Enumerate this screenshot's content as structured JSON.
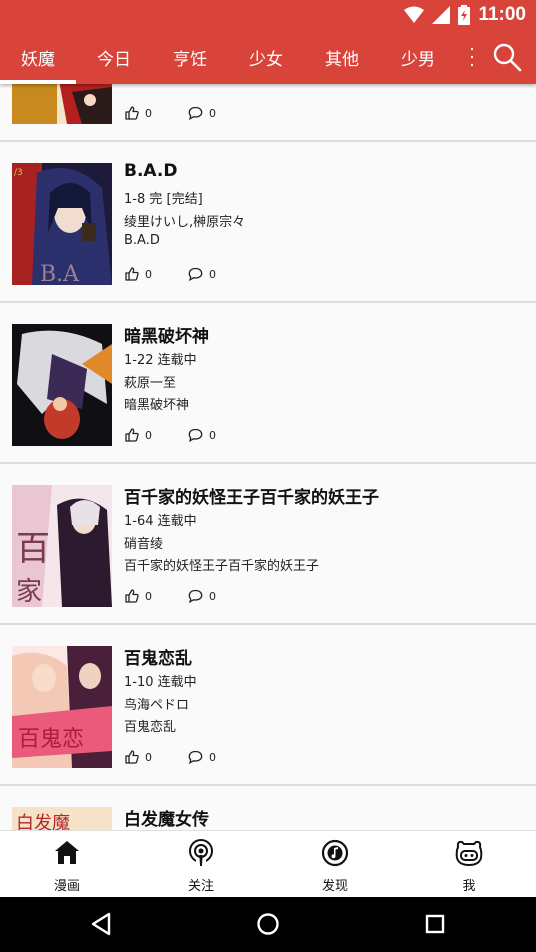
{
  "status_bar": {
    "time": "11:00"
  },
  "tabs": [
    {
      "label": "妖魔",
      "active": true
    },
    {
      "label": "今日"
    },
    {
      "label": "亨饪"
    },
    {
      "label": "少女"
    },
    {
      "label": "其他"
    },
    {
      "label": "少男"
    }
  ],
  "colors": {
    "primary": "#d8443a",
    "divider": "#dddddd",
    "background": "#fafafa"
  },
  "partial_item": {
    "likes": "0",
    "comments": "0"
  },
  "items": [
    {
      "title": "B.A.D",
      "chapters": "1-8 完 [完结]",
      "author": "绫里けいし,榊原宗々",
      "subtitle": "B.A.D",
      "likes": "0",
      "comments": "0"
    },
    {
      "title": "暗黑破坏神",
      "chapters": "1-22 连载中",
      "author": "萩原一至",
      "subtitle": "暗黑破坏神",
      "likes": "0",
      "comments": "0"
    },
    {
      "title": "百千家的妖怪王子百千家的妖王子",
      "chapters": "1-64 连载中",
      "author": "硝音绫",
      "subtitle": "百千家的妖怪王子百千家的妖王子",
      "likes": "0",
      "comments": "0"
    },
    {
      "title": "百鬼恋乱",
      "chapters": "1-10 连载中",
      "author": "鸟海ペドロ",
      "subtitle": "百鬼恋乱",
      "likes": "0",
      "comments": "0"
    },
    {
      "title": "白发魔女传"
    }
  ],
  "bottom_nav": [
    {
      "label": "漫画",
      "icon": "home-icon"
    },
    {
      "label": "关注",
      "icon": "podcast-icon"
    },
    {
      "label": "发现",
      "icon": "music-disc-icon"
    },
    {
      "label": "我",
      "icon": "mascot-face-icon"
    }
  ]
}
